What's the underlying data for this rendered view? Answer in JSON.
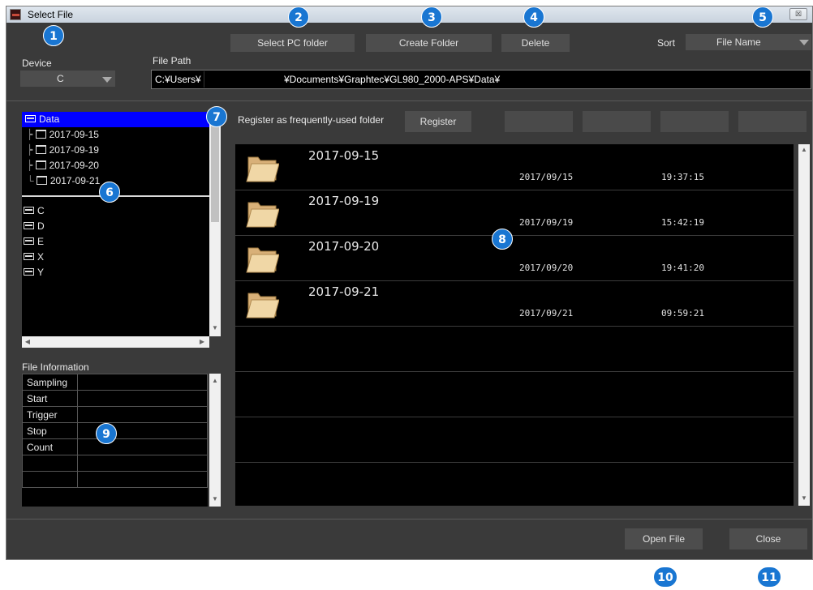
{
  "window": {
    "title": "Select File",
    "close_glyph": "☒"
  },
  "toolbar": {
    "select_pc_folder": "Select PC folder",
    "create_folder": "Create Folder",
    "delete": "Delete",
    "sort_label": "Sort",
    "sort_value": "File Name"
  },
  "device": {
    "label": "Device",
    "value": "C"
  },
  "file_path": {
    "label": "File Path",
    "prefix": "C:¥Users¥",
    "suffix": "¥Documents¥Graphtec¥GL980_2000-APS¥Data¥"
  },
  "tree": {
    "root": "Data",
    "folders": [
      "2017-09-15",
      "2017-09-19",
      "2017-09-20",
      "2017-09-21"
    ],
    "drives": [
      "C",
      "D",
      "E",
      "X",
      "Y"
    ]
  },
  "register": {
    "label": "Register as frequently-used folder",
    "button": "Register"
  },
  "file_list": [
    {
      "name": "2017-09-15",
      "date": "2017/09/15",
      "time": "19:37:15"
    },
    {
      "name": "2017-09-19",
      "date": "2017/09/19",
      "time": "15:42:19"
    },
    {
      "name": "2017-09-20",
      "date": "2017/09/20",
      "time": "19:41:20"
    },
    {
      "name": "2017-09-21",
      "date": "2017/09/21",
      "time": "09:59:21"
    }
  ],
  "file_info": {
    "title": "File Information",
    "rows": [
      "Sampling",
      "Start",
      "Trigger",
      "Stop",
      "Count"
    ]
  },
  "footer": {
    "open_file": "Open File",
    "close": "Close"
  },
  "callouts": [
    "1",
    "2",
    "3",
    "4",
    "5",
    "6",
    "7",
    "8",
    "9",
    "10",
    "11"
  ],
  "colors": {
    "callout": "#1976d2",
    "selection": "#0000ff",
    "background": "#3a3a3a",
    "panel": "#000000"
  }
}
